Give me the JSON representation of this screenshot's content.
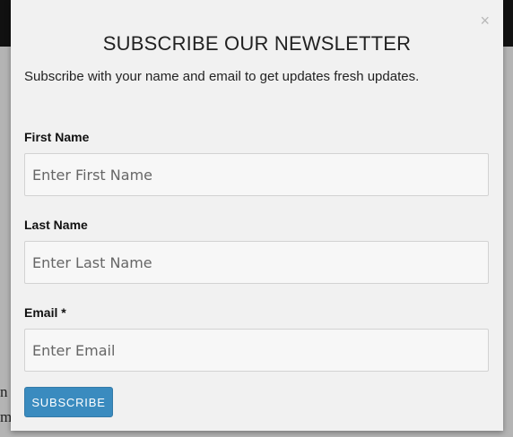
{
  "background": {
    "text_fragments": [
      "n",
      "m"
    ]
  },
  "modal": {
    "close_label": "×",
    "title": "SUBSCRIBE OUR NEWSLETTER",
    "description": "Subscribe with your name and email to get updates fresh updates.",
    "fields": [
      {
        "label": "First Name",
        "placeholder": "Enter First Name"
      },
      {
        "label": "Last Name",
        "placeholder": "Enter Last Name"
      },
      {
        "label": "Email *",
        "placeholder": "Enter Email"
      }
    ],
    "submit_label": "SUBSCRIBE"
  },
  "colors": {
    "accent": "#3a8bbf",
    "modal_bg": "#f1f1f1",
    "topbar": "#111111"
  }
}
